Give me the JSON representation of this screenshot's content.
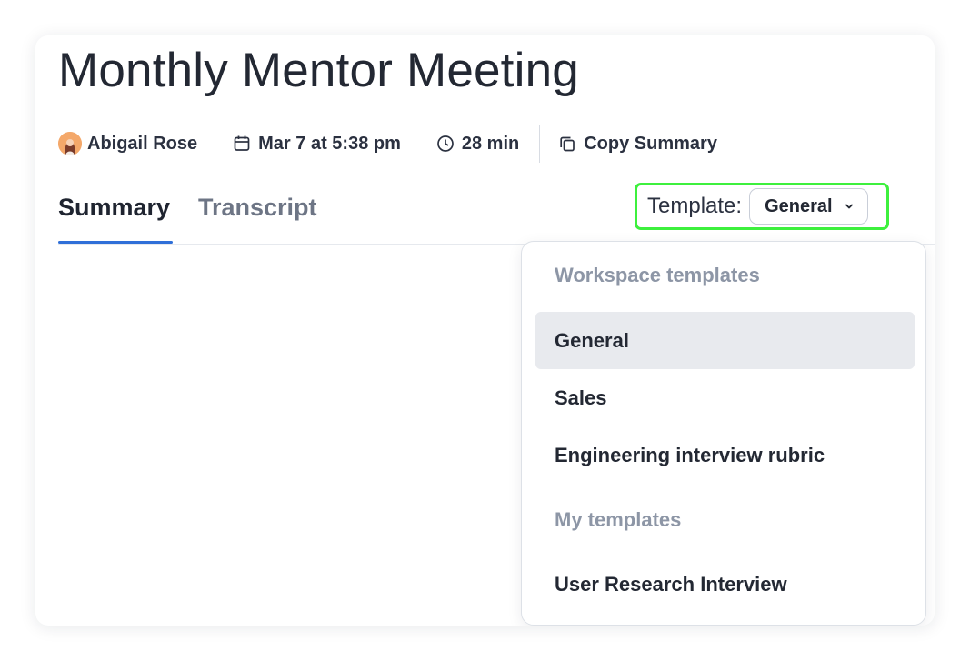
{
  "meeting": {
    "title": "Monthly Mentor Meeting",
    "owner": "Abigail Rose",
    "date": "Mar 7 at 5:38 pm",
    "duration": "28 min",
    "copy_label": "Copy Summary"
  },
  "tabs": [
    {
      "label": "Summary",
      "active": true
    },
    {
      "label": "Transcript",
      "active": false
    }
  ],
  "template": {
    "label": "Template:",
    "selected": "General"
  },
  "dropdown": {
    "groups": [
      {
        "heading": "Workspace templates",
        "items": [
          {
            "label": "General",
            "selected": true
          },
          {
            "label": "Sales",
            "selected": false
          },
          {
            "label": "Engineering interview rubric",
            "selected": false
          }
        ]
      },
      {
        "heading": "My templates",
        "items": [
          {
            "label": "User Research Interview",
            "selected": false
          }
        ]
      }
    ]
  },
  "colors": {
    "accent": "#2f6fd8",
    "highlight_box": "#3df03d",
    "selected_item_bg": "#e8eaee"
  },
  "icons": {
    "owner": "avatar",
    "date": "calendar-icon",
    "duration": "clock-icon",
    "copy": "copy-icon",
    "select": "chevron-down-icon"
  }
}
